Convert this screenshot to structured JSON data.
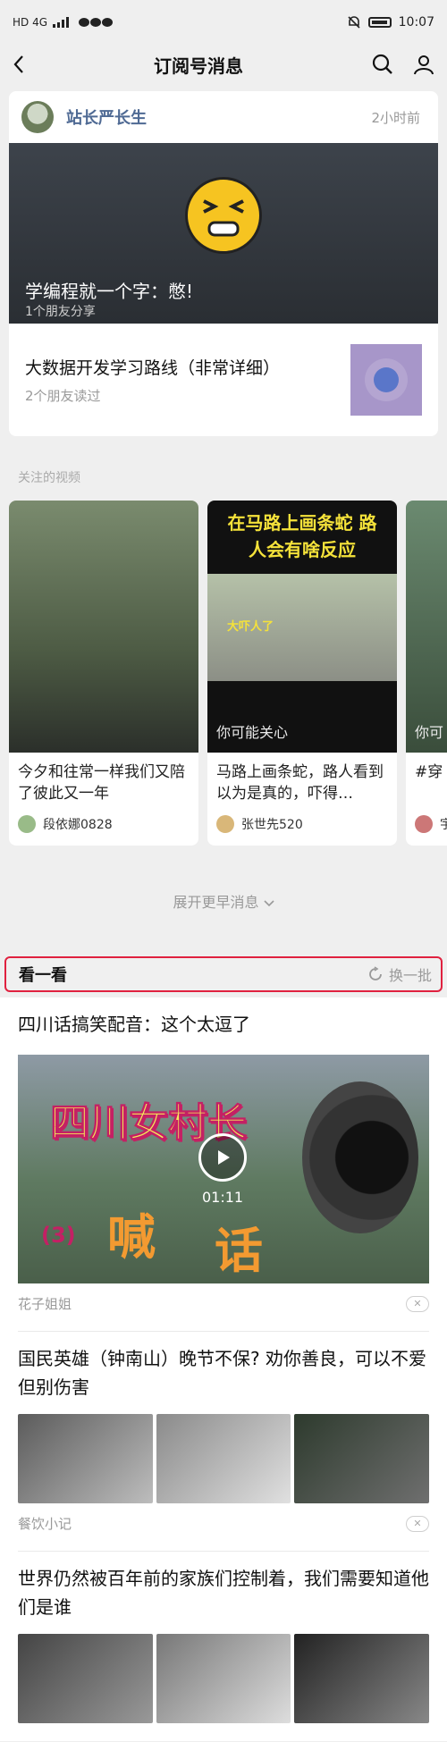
{
  "status": {
    "left_text": "HD 4G",
    "time": "10:07"
  },
  "nav": {
    "title": "订阅号消息"
  },
  "top_card": {
    "author": "站长严长生",
    "time_ago": "2小时前",
    "hero_title": "学编程就一个字：憋!",
    "hero_sub": "1个朋友分享",
    "article_title": "大数据开发学习路线（非常详细）",
    "article_sub": "2个朋友读过"
  },
  "videos_section": {
    "label": "关注的视频",
    "items": [
      {
        "title": "今夕和往常一样我们又陪了彼此又一年",
        "author": "段依娜0828"
      },
      {
        "title": "马路上画条蛇，路人看到以为是真的，吓得…",
        "author": "张世先520",
        "overlay_top": "在马路上画条蛇 路人会有啥反应",
        "overlay_tag": "大吓人了",
        "maybe": "你可能关心"
      },
      {
        "title": "#穿",
        "author": "宇",
        "maybe": "你可"
      }
    ]
  },
  "expand": {
    "label": "展开更早消息"
  },
  "see": {
    "title": "看一看",
    "refresh": "换一批"
  },
  "feed": [
    {
      "title": "四川话搞笑配音：这个太逗了",
      "source": "花子姐姐",
      "video_headline": "四川女村长",
      "video_big1": "喊",
      "video_big2": "话",
      "video_num": "(3)",
      "duration": "01:11"
    },
    {
      "title": "国民英雄（钟南山）晚节不保? 劝你善良，可以不爱但别伤害",
      "source": "餐饮小记"
    },
    {
      "title": "世界仍然被百年前的家族们控制着，我们需要知道他们是谁",
      "source": ""
    }
  ]
}
